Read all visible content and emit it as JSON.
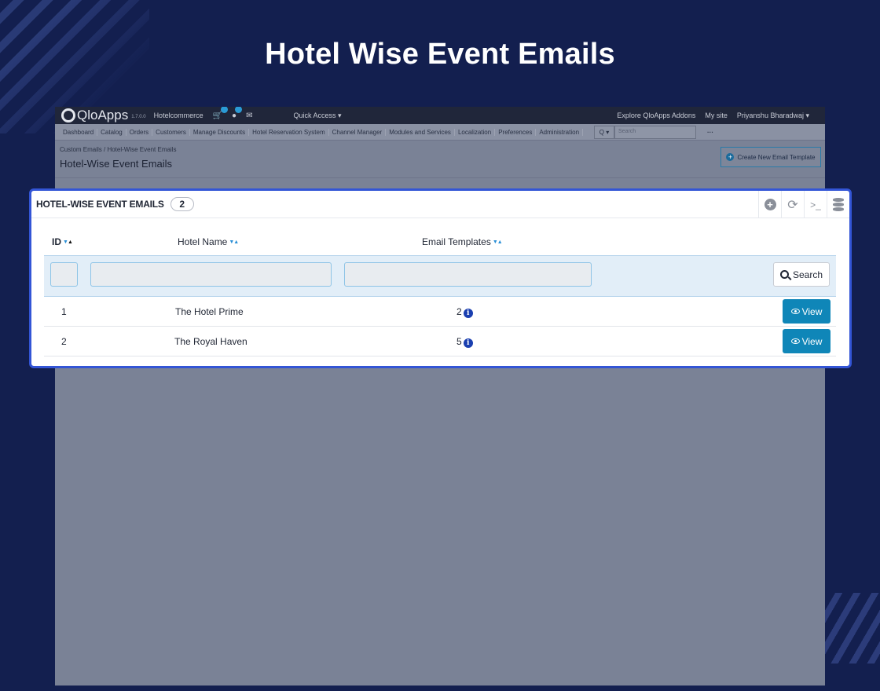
{
  "hero": {
    "title": "Hotel Wise Event Emails"
  },
  "topbar": {
    "logo_text": "QloApps",
    "version": "1.7.0.0",
    "shop_name": "Hotelcommerce",
    "quick_access": "Quick Access ▾",
    "explore_addons": "Explore QloApps Addons",
    "my_site": "My site",
    "user": "Priyanshu Bharadwaj ▾",
    "icons": [
      "cart-icon",
      "user-icon",
      "mail-icon"
    ]
  },
  "menubar": {
    "items": [
      {
        "label": "Dashboard",
        "icon": "dashboard-icon"
      },
      {
        "label": "Catalog",
        "icon": "book-icon"
      },
      {
        "label": "Orders",
        "icon": "card-icon"
      },
      {
        "label": "Customers",
        "icon": "users-icon"
      },
      {
        "label": "Manage Discounts",
        "icon": "tag-icon"
      },
      {
        "label": "Hotel Reservation System",
        "icon": "bed-icon"
      },
      {
        "label": "Channel Manager",
        "icon": "refresh-icon"
      },
      {
        "label": "Modules and Services",
        "icon": "puzzle-icon"
      },
      {
        "label": "Localization",
        "icon": "globe-icon"
      },
      {
        "label": "Preferences",
        "icon": "wrench-icon"
      },
      {
        "label": "Administration",
        "icon": "cog-icon"
      }
    ],
    "search_placeholder": "Search",
    "search_type": "Q ▾",
    "more": "···"
  },
  "header": {
    "breadcrumb": "Custom Emails  /  Hotel-Wise Event Emails",
    "title": "Hotel-Wise Event Emails",
    "create_button": "Create New Email Template"
  },
  "panel": {
    "title": "HOTEL-WISE EVENT EMAILS",
    "count": "2",
    "columns": {
      "id": "ID",
      "hotel_name": "Hotel Name",
      "email_templates": "Email Templates"
    },
    "search_button": "Search",
    "view_label": "View",
    "rows": [
      {
        "id": "1",
        "hotel_name": "The Hotel Prime",
        "email_templates": "2"
      },
      {
        "id": "2",
        "hotel_name": "The Royal Haven",
        "email_templates": "5"
      }
    ]
  }
}
